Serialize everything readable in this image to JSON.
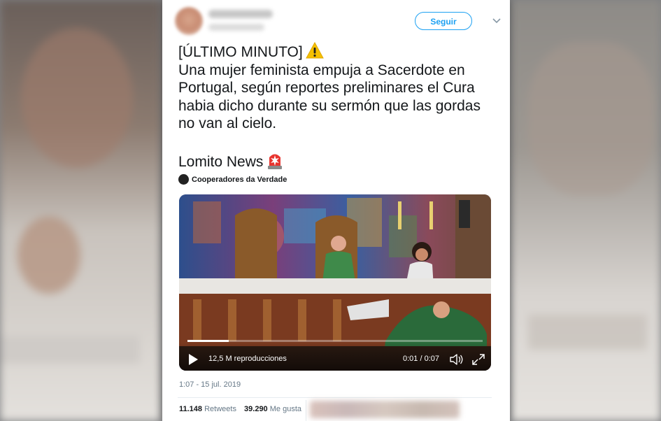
{
  "header": {
    "follow_label": "Seguir"
  },
  "tweet": {
    "line1": "[ÚLTIMO MINUTO]",
    "body": "Una mujer feminista empuja a Sacerdote en Portugal, según reportes preliminares el Cura habia dicho durante su sermón que las gordas no van al cielo.",
    "signature": "Lomito News",
    "emoji_1": "warning-emoji",
    "emoji_2": "police-light-emoji"
  },
  "source": {
    "name": "Cooperadores da Verdade"
  },
  "video": {
    "views": "12,5 M reproducciones",
    "time": "0:01 / 0:07",
    "progress": 0.14
  },
  "meta": {
    "timestamp": "1:07 - 15 jul. 2019"
  },
  "stats": {
    "retweets_count": "11.148",
    "retweets_label": "Retweets",
    "likes_count": "39.290",
    "likes_label": "Me gusta"
  },
  "colors": {
    "accent": "#1da1f2",
    "text": "#14171a",
    "muted": "#657786"
  }
}
